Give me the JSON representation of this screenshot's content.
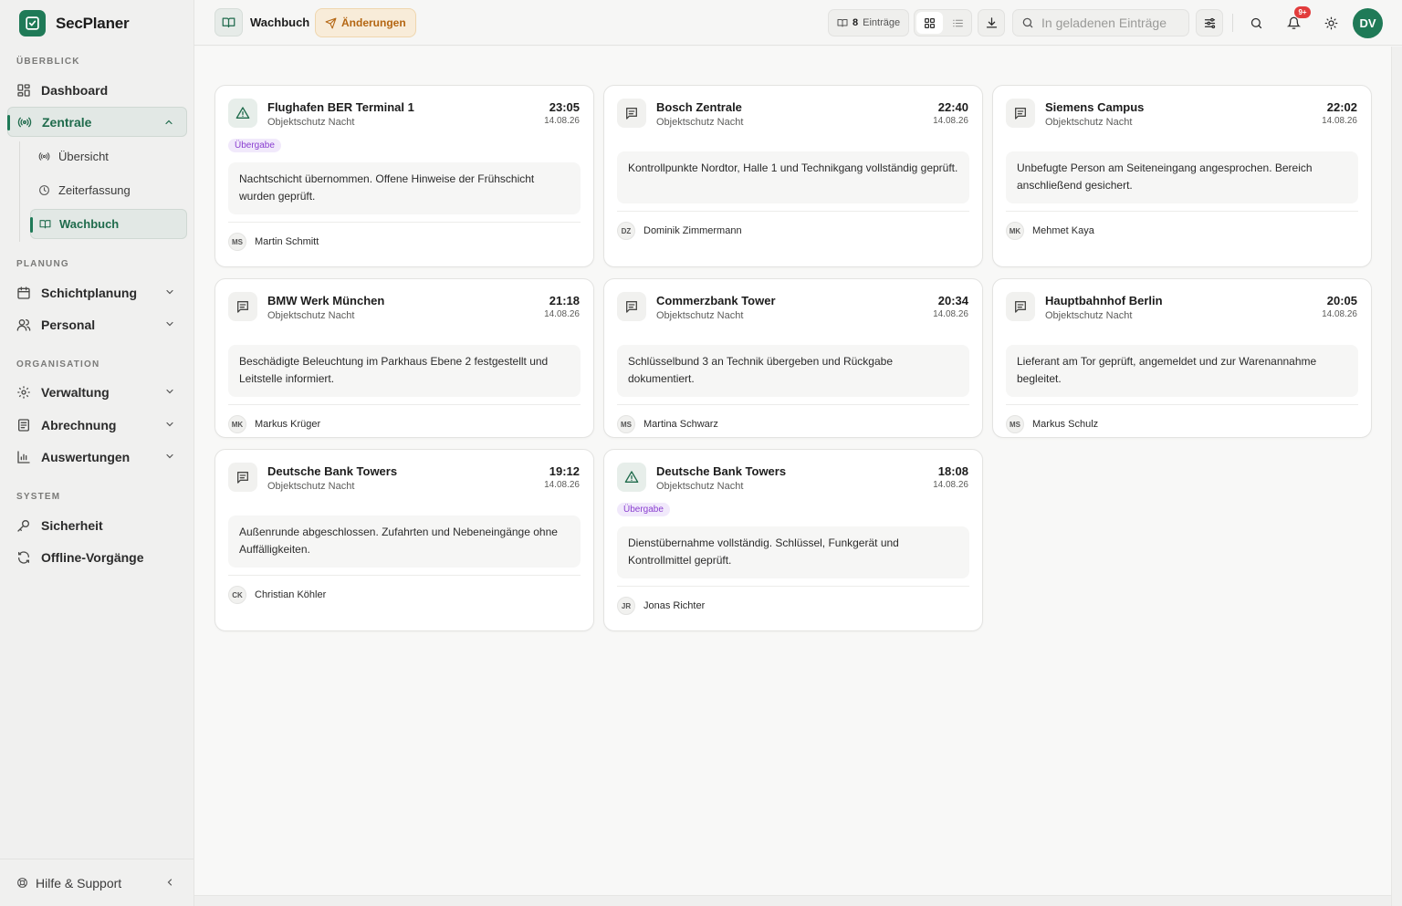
{
  "brand": {
    "name": "SecPlaner"
  },
  "sidebar": {
    "sections": {
      "overview": "ÜBERBLICK",
      "planning": "PLANUNG",
      "organisation": "ORGANISATION",
      "system": "SYSTEM"
    },
    "items": {
      "dashboard": "Dashboard",
      "zentrale": "Zentrale",
      "uebersicht": "Übersicht",
      "zeiterfassung": "Zeiterfassung",
      "wachbuch": "Wachbuch",
      "schichtplanung": "Schichtplanung",
      "personal": "Personal",
      "verwaltung": "Verwaltung",
      "abrechnung": "Abrechnung",
      "auswertungen": "Auswertungen",
      "sicherheit": "Sicherheit",
      "offline": "Offline-Vorgänge"
    },
    "footer": "Hilfe & Support"
  },
  "topbar": {
    "title": "Wachbuch",
    "changes_label": "Änderungen",
    "entries_count": "8",
    "entries_label": "Einträge",
    "search_placeholder": "In geladenen Einträge",
    "notifications_badge": "9+",
    "avatar_initials": "DV"
  },
  "colors": {
    "brand": "#1f7a57",
    "tag": "#8a3fd0",
    "warning": "#b46612",
    "badge": "#e23c3c"
  },
  "cards": [
    {
      "site": "Flughafen BER Terminal 1",
      "shift": "Objektschutz Nacht",
      "time": "23:05",
      "date": "14.08.26",
      "icon": "warning-triangle-icon",
      "tag": "Übergabe",
      "text": "Nachtschicht übernommen. Offene Hinweise der Frühschicht wurden geprüft.",
      "initials": "MS",
      "author": "Martin Schmitt"
    },
    {
      "site": "Bosch Zentrale",
      "shift": "Objektschutz Nacht",
      "time": "22:40",
      "date": "14.08.26",
      "icon": "message-icon",
      "tag": "",
      "text": "Kontrollpunkte Nordtor, Halle 1 und Technikgang vollständig geprüft.",
      "initials": "DZ",
      "author": "Dominik Zimmermann"
    },
    {
      "site": "Siemens Campus",
      "shift": "Objektschutz Nacht",
      "time": "22:02",
      "date": "14.08.26",
      "icon": "message-icon",
      "tag": "",
      "text": "Unbefugte Person am Seiteneingang angesprochen. Bereich anschließend gesichert.",
      "initials": "MK",
      "author": "Mehmet Kaya"
    },
    {
      "site": "BMW Werk München",
      "shift": "Objektschutz Nacht",
      "time": "21:18",
      "date": "14.08.26",
      "icon": "message-icon",
      "tag": "",
      "text": "Beschädigte Beleuchtung im Parkhaus Ebene 2 festgestellt und Leitstelle informiert.",
      "initials": "MK",
      "author": "Markus Krüger"
    },
    {
      "site": "Commerzbank Tower",
      "shift": "Objektschutz Nacht",
      "time": "20:34",
      "date": "14.08.26",
      "icon": "message-icon",
      "tag": "",
      "text": "Schlüsselbund 3 an Technik übergeben und Rückgabe dokumentiert.",
      "initials": "MS",
      "author": "Martina Schwarz"
    },
    {
      "site": "Hauptbahnhof Berlin",
      "shift": "Objektschutz Nacht",
      "time": "20:05",
      "date": "14.08.26",
      "icon": "message-icon",
      "tag": "",
      "text": "Lieferant am Tor geprüft, angemeldet und zur Warenannahme begleitet.",
      "initials": "MS",
      "author": "Markus Schulz"
    },
    {
      "site": "Deutsche Bank Towers",
      "shift": "Objektschutz Nacht",
      "time": "19:12",
      "date": "14.08.26",
      "icon": "message-icon",
      "tag": "",
      "text": "Außenrunde abgeschlossen. Zufahrten und Nebeneingänge ohne Auffälligkeiten.",
      "initials": "CK",
      "author": "Christian Köhler"
    },
    {
      "site": "Deutsche Bank Towers",
      "shift": "Objektschutz Nacht",
      "time": "18:08",
      "date": "14.08.26",
      "icon": "warning-triangle-icon",
      "tag": "Übergabe",
      "text": "Dienstübernahme vollständig. Schlüssel, Funkgerät und Kontrollmittel geprüft.",
      "initials": "JR",
      "author": "Jonas Richter"
    }
  ]
}
